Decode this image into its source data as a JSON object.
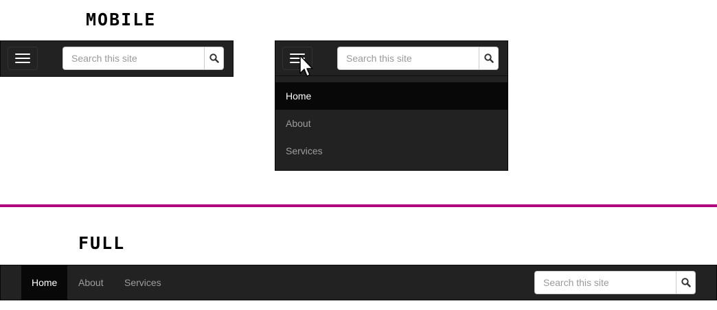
{
  "sections": {
    "mobile_title": "MOBILE",
    "full_title": "FULL"
  },
  "search": {
    "placeholder": "Search this site",
    "icon": "search-icon"
  },
  "nav": {
    "items": [
      {
        "label": "Home",
        "active": true
      },
      {
        "label": "About"
      },
      {
        "label": "Services"
      }
    ]
  },
  "colors": {
    "navbar": "#222222",
    "active": "#080808",
    "divider": "#b0007f"
  }
}
